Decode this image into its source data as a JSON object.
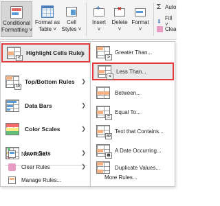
{
  "ribbon": {
    "conditional_formatting": "Conditional\nFormatting ˅",
    "format_as_table": "Format as\nTable ˅",
    "cell_styles": "Cell\nStyles ˅",
    "insert": "Insert\n˅",
    "delete": "Delete\n˅",
    "format": "Format\n˅",
    "autosum": "Auto",
    "fill": "Fill ˅",
    "clear": "Clea"
  },
  "menu": {
    "items": [
      {
        "label": "Highlight Cells Rules",
        "icon": "highlight-cells-icon"
      },
      {
        "label": "Top/Bottom Rules",
        "icon": "top-bottom-icon"
      },
      {
        "label": "Data Bars",
        "icon": "data-bars-icon"
      },
      {
        "label": "Color Scales",
        "icon": "color-scales-icon"
      },
      {
        "label": "Icon Sets",
        "icon": "icon-sets-icon"
      }
    ],
    "small_items": [
      {
        "label": "New Rule...",
        "icon": "new-rule-icon"
      },
      {
        "label": "Clear Rules",
        "icon": "clear-rules-icon"
      },
      {
        "label": "Manage Rules...",
        "icon": "manage-rules-icon"
      }
    ]
  },
  "submenu": {
    "items": [
      {
        "label": "Greater Than...",
        "icon": "greater-than-icon"
      },
      {
        "label": "Less Than...",
        "icon": "less-than-icon"
      },
      {
        "label": "Between...",
        "icon": "between-icon"
      },
      {
        "label": "Equal To...",
        "icon": "equal-to-icon"
      },
      {
        "label": "Text that Contains...",
        "icon": "text-contains-icon"
      },
      {
        "label": "A Date Occurring...",
        "icon": "date-occurring-icon"
      },
      {
        "label": "Duplicate Values...",
        "icon": "duplicate-values-icon"
      }
    ],
    "more": "More Rules..."
  },
  "colors": {
    "highlight_border": "#e23a3a",
    "hover_bg": "#e9e9e9",
    "orange_fill": "#f4b183",
    "blue_fill": "#5b9bd5"
  }
}
